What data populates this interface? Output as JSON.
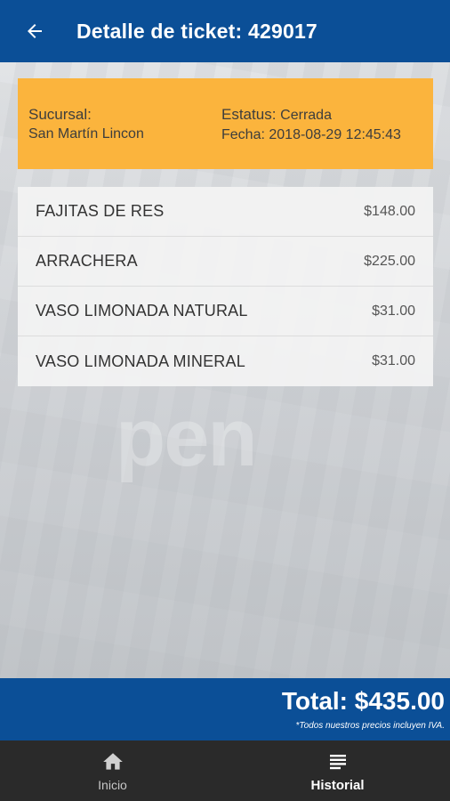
{
  "header": {
    "title": "Detalle de ticket: 429017"
  },
  "ticket": {
    "sucursal_label": "Sucursal:",
    "sucursal": "San Martín Lincon",
    "estatus_label": "Estatus:",
    "estatus": "Cerrada",
    "fecha_label": "Fecha:",
    "fecha": "2018-08-29 12:45:43"
  },
  "items": [
    {
      "name": "FAJITAS DE RES",
      "price": "$148.00"
    },
    {
      "name": "ARRACHERA",
      "price": "$225.00"
    },
    {
      "name": "VASO LIMONADA NATURAL",
      "price": "$31.00"
    },
    {
      "name": "VASO LIMONADA MINERAL",
      "price": "$31.00"
    }
  ],
  "total": {
    "label": "Total: $435.00",
    "note": "*Todos nuestros precios incluyen IVA."
  },
  "nav": {
    "items": [
      {
        "label": "Inicio",
        "icon": "home-icon"
      },
      {
        "label": "Historial",
        "icon": "list-icon"
      }
    ]
  },
  "background": {
    "logo_text": "pen"
  },
  "colors": {
    "primary": "#0b4f97",
    "accent": "#fbb43d",
    "navbar": "#2a2a2a"
  }
}
